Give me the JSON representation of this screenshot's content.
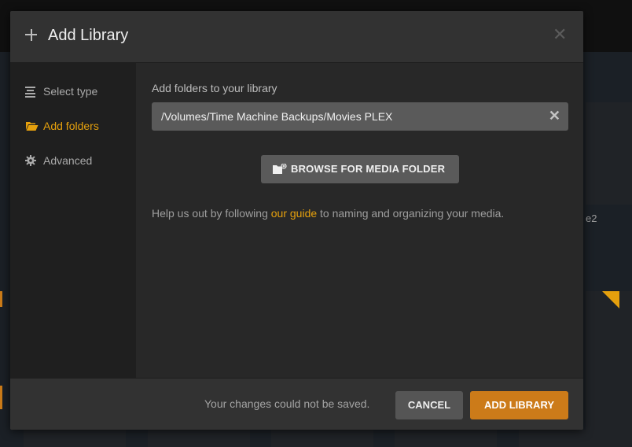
{
  "modal": {
    "title": "Add Library",
    "close_icon": "close-icon"
  },
  "sidebar": {
    "items": [
      {
        "label": "Select type",
        "icon": "list-icon",
        "active": false
      },
      {
        "label": "Add folders",
        "icon": "folder-open-icon",
        "active": true
      },
      {
        "label": "Advanced",
        "icon": "gear-icon",
        "active": false
      }
    ]
  },
  "content": {
    "section_label": "Add folders to your library",
    "folder_path": "/Volumes/Time Machine Backups/Movies PLEX",
    "browse_button": "BROWSE FOR MEDIA FOLDER",
    "help_prefix": "Help us out by following ",
    "help_link": "our guide",
    "help_suffix": " to naming and organizing your media."
  },
  "footer": {
    "message": "Your changes could not be saved.",
    "cancel_label": "CANCEL",
    "add_label": "ADD LIBRARY"
  },
  "background": {
    "partial_label": "e2"
  },
  "colors": {
    "accent": "#e5a00d",
    "primary_button": "#cc7b19"
  }
}
